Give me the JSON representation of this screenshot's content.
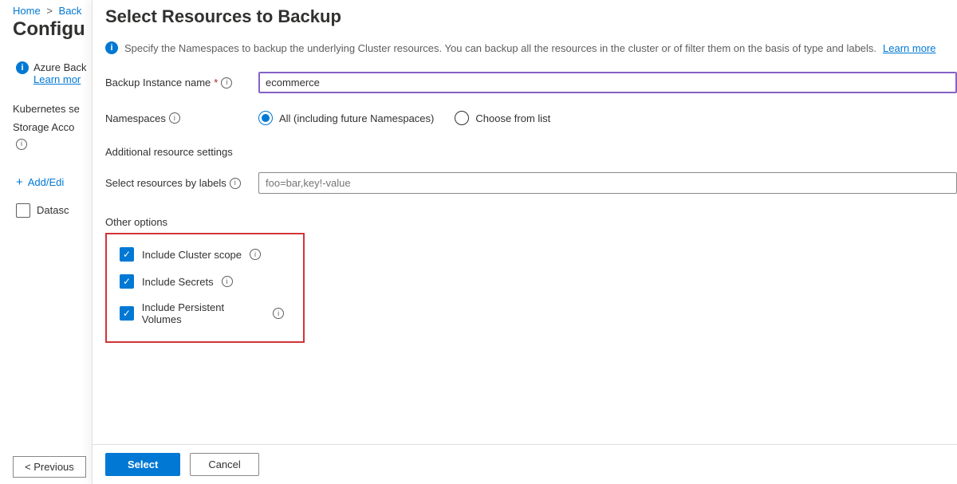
{
  "breadcrumb": {
    "home": "Home",
    "back": "Back"
  },
  "background": {
    "page_title": "Configu",
    "info_text": "Azure Back",
    "learn_more": "Learn mor",
    "section1": "Kubernetes se",
    "section2": "Storage Acco",
    "add_edit": "Add/Edi",
    "datasource": "Datasc",
    "previous_button": "< Previous"
  },
  "blade": {
    "title": "Select Resources to Backup",
    "info_text": "Specify the Namespaces to backup the underlying Cluster resources. You can backup all the resources in the cluster or of filter them on the basis of type and labels.",
    "learn_more": "Learn more",
    "instance_label": "Backup Instance name",
    "instance_value": "ecommerce",
    "namespaces_label": "Namespaces",
    "radio_all": "All (including future Namespaces)",
    "radio_choose": "Choose from list",
    "additional_header": "Additional resource settings",
    "labels_label": "Select resources by labels",
    "labels_placeholder": "foo=bar,key!-value",
    "other_header": "Other options",
    "cb_cluster": "Include Cluster scope",
    "cb_secrets": "Include Secrets",
    "cb_pv": "Include Persistent Volumes",
    "select_button": "Select",
    "cancel_button": "Cancel"
  }
}
